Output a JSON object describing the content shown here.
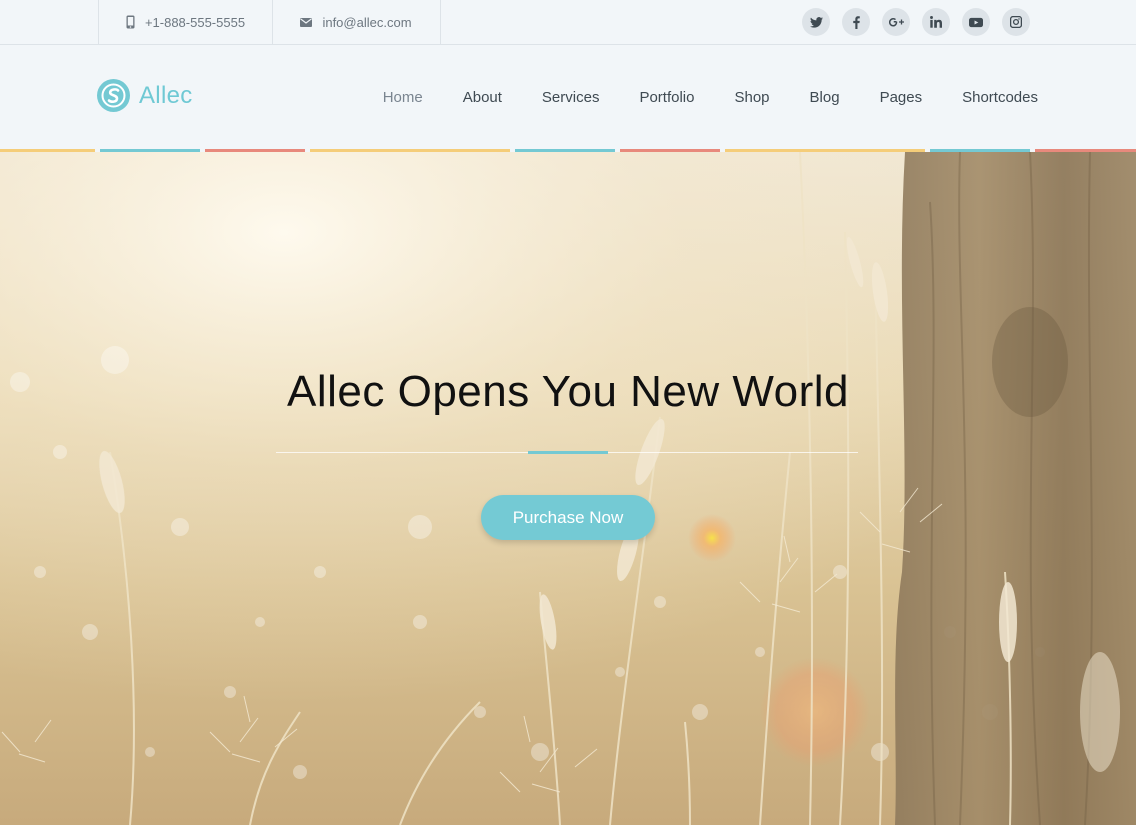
{
  "topbar": {
    "phone": "+1-888-555-5555",
    "email": "info@allec.com",
    "phone_icon": "mobile-phone-icon",
    "email_icon": "envelope-icon",
    "socials": [
      "twitter-icon",
      "facebook-icon",
      "google-plus-icon",
      "linkedin-icon",
      "youtube-icon",
      "instagram-icon"
    ]
  },
  "header": {
    "logo_text": "Allec",
    "nav": [
      "Home",
      "About",
      "Services",
      "Portfolio",
      "Shop",
      "Blog",
      "Pages",
      "Shortcodes"
    ],
    "active_nav": "Home"
  },
  "hero": {
    "title": "Allec Opens You New World",
    "button": "Purchase Now"
  },
  "colors": {
    "brand": "#74c9d3",
    "stripe": [
      "#f5cd79",
      "#74c9d3",
      "#e8897c"
    ]
  }
}
